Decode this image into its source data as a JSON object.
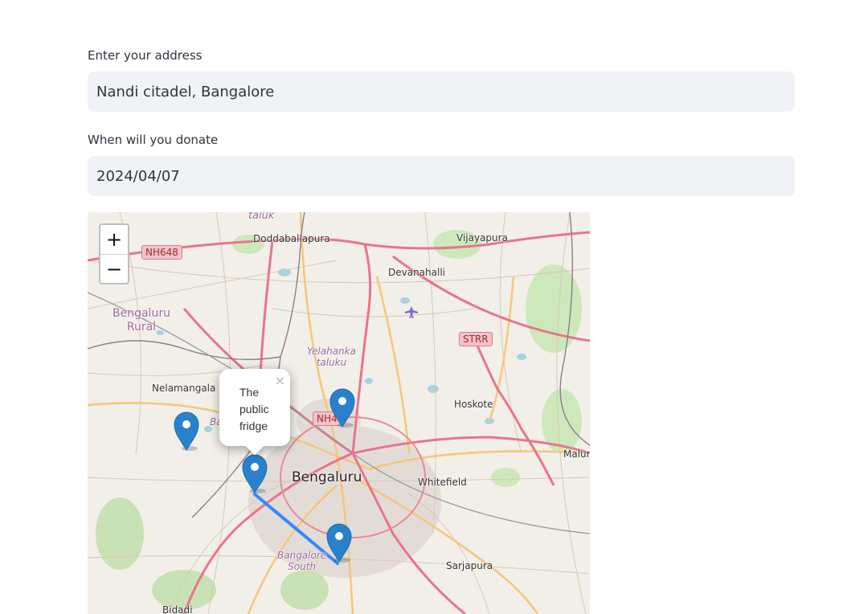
{
  "form": {
    "address_label": "Enter your address",
    "address_value": "Nandi citadel, Bangalore",
    "date_label": "When will you donate",
    "date_value": "2024/04/07"
  },
  "map": {
    "zoom_in": "+",
    "zoom_out": "−",
    "popup_text": "The public fridge",
    "popup_close": "×",
    "marker_color": "#2a81cb",
    "route_color": "#3388ff",
    "places": {
      "taluk": "taluk",
      "doddaballapura": "Doddaballapura",
      "vijayapura": "Vijayapura",
      "devanahalli": "Devanahalli",
      "bengaluru_rural_1": "Bengaluru",
      "bengaluru_rural_2": "Rural",
      "yelahanka_1": "Yelahanka",
      "yelahanka_2": "taluku",
      "nelamangala": "Nelamangala",
      "hoskote": "Hoskote",
      "malur": "Malur",
      "bengaluru": "Bengaluru",
      "whitefield": "Whitefield",
      "bangalore_south_1": "Bangalore",
      "bangalore_south_2": "South",
      "sarjapura": "Sarjapura",
      "bidadi": "Bidadi",
      "ba_partial": "Ba"
    },
    "shields": {
      "nh648": "NH648",
      "strr": "STRR",
      "nh4": "NH4"
    }
  }
}
